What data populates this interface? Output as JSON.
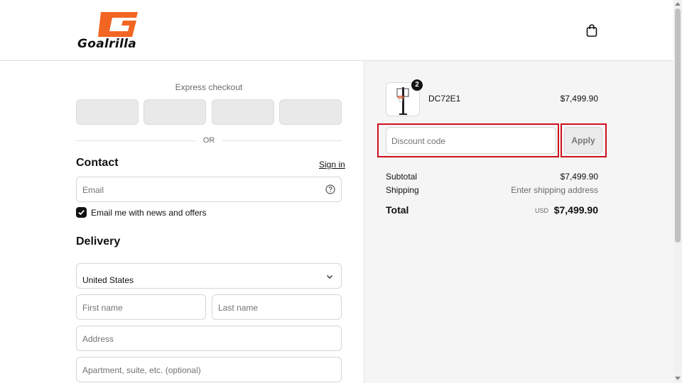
{
  "brand": {
    "name": "Goalrilla",
    "accent_color": "#f26522"
  },
  "header": {
    "cart_icon": "shopping-bag-icon"
  },
  "express_checkout": {
    "title": "Express checkout",
    "or_label": "OR"
  },
  "contact": {
    "title": "Contact",
    "sign_in": "Sign in",
    "email_placeholder": "Email",
    "newsletter_label": "Email me with news and offers",
    "newsletter_checked": true
  },
  "delivery": {
    "title": "Delivery",
    "country": "United States",
    "first_name_placeholder": "First name",
    "last_name_placeholder": "Last name",
    "address_placeholder": "Address",
    "apartment_placeholder": "Apartment, suite, etc. (optional)"
  },
  "order": {
    "item": {
      "quantity": "2",
      "name": "DC72E1",
      "price": "$7,499.90"
    },
    "discount_placeholder": "Discount code",
    "apply_label": "Apply",
    "subtotal_label": "Subtotal",
    "subtotal_value": "$7,499.90",
    "shipping_label": "Shipping",
    "shipping_value": "Enter shipping address",
    "total_label": "Total",
    "total_currency": "USD",
    "total_value": "$7,499.90"
  },
  "highlight_color": "#d0101a"
}
